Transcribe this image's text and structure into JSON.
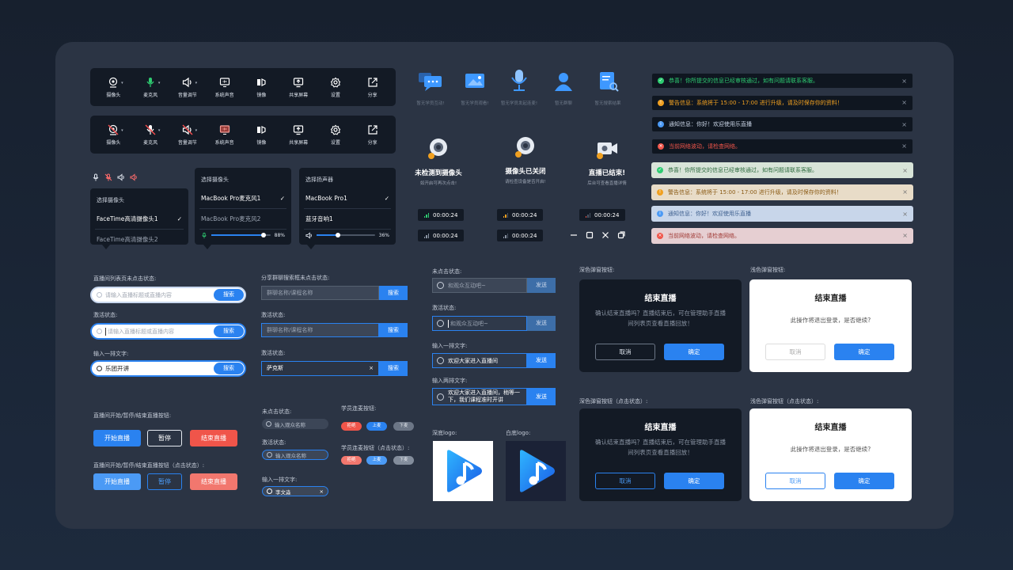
{
  "toolbar_items": [
    "摄像头",
    "麦克风",
    "音量调节",
    "系统声音",
    "镜像",
    "共享屏幕",
    "设置",
    "分享"
  ],
  "camera_dropdown": {
    "title": "选择摄像头",
    "options": [
      "FaceTime高清摄像头1",
      "FaceTime高清摄像头2"
    ]
  },
  "mic_dropdown": {
    "title": "选择摄像头",
    "options": [
      "MacBook Pro麦克风1",
      "MacBook Pro麦克风2"
    ],
    "volume_label": "88%",
    "volume": 0.88
  },
  "speaker_dropdown": {
    "title": "选择扬声器",
    "options": [
      "MacBook Pro1",
      "蓝牙音响1"
    ],
    "volume_label": "36%",
    "volume": 0.36
  },
  "search_rounded": {
    "label1": "直播间列表页未点击状态:",
    "label2": "激活状态:",
    "label3": "输入一排文字:",
    "placeholder": "请输入直播标题或直播内容",
    "value": "乐团开讲",
    "button": "搜索"
  },
  "search_square": {
    "label1": "分享群聊搜索框未点击状态:",
    "label2": "激活状态:",
    "label3": "激活状态:",
    "placeholder": "群聊名称/课程名称",
    "value": "萨克斯",
    "button": "搜索",
    "clear": "×"
  },
  "live_buttons": {
    "label1": "直播间开始/暂停/结束直播按钮:",
    "label2": "直播间开始/暂停/结束直播按钮（点击状态）:",
    "start": "开始直播",
    "pause": "暂停",
    "end": "结束直播"
  },
  "member_search": {
    "label1": "未点击状态:",
    "label2": "激活状态:",
    "label3": "输入一排文字:",
    "placeholder": "输入观众名称",
    "value": "李文淼",
    "clear": "×"
  },
  "student_buttons": {
    "label1": "学员连麦按钮:",
    "label2": "学员连麦按钮（点击状态）:",
    "reject": "拒绝",
    "up": "上麦",
    "down": "下麦"
  },
  "empty_states": [
    "暂无学员互动!",
    "暂无学员观看!",
    "暂无学员发起连麦!",
    "暂无群聊",
    "暂无搜索结果"
  ],
  "camera_states": [
    {
      "title": "未检测到摄像头",
      "sub": "如开启可再次点击!"
    },
    {
      "title": "摄像头已关闭",
      "sub": "请检查设备是否开启!"
    },
    {
      "title": "直播已结束!",
      "sub": "后台可查看直播详情"
    }
  ],
  "timers": [
    "00:00:24",
    "00:00:24",
    "00:00:24",
    "00:00:24",
    "00:00:24"
  ],
  "window_controls": [
    "minimize-icon",
    "maximize-icon",
    "close-icon",
    "restore-icon"
  ],
  "chat_inputs": {
    "label1": "未点击状态:",
    "label2": "激活状态:",
    "label3": "输入一排文字:",
    "label4": "输入两排文字:",
    "placeholder": "和观众互动吧~",
    "value1": "欢迎大家进入直播间",
    "value2a": "欢迎大家进入直播间，稍等一",
    "value2b": "下，我们课程准时开讲",
    "send": "发送"
  },
  "logos": {
    "dark_label": "深底logo:",
    "light_label": "白底logo:"
  },
  "notifications": [
    {
      "type": "success",
      "text": "恭喜！你所提交的信息已经审核通过，如有问题请联系客服。"
    },
    {
      "type": "warning",
      "text": "警告信息：系统将于 15:00 - 17:00 进行升级，请及时保存你的资料！"
    },
    {
      "type": "info",
      "text": "通知信息：你好！欢迎使用乐直播"
    },
    {
      "type": "error",
      "text": "当前网络波动，请检查网络。"
    }
  ],
  "modals": {
    "dark_label": "深色弹窗按钮:",
    "light_label": "浅色弹窗按钮:",
    "dark_label_pressed": "深色弹窗按钮（点击状态）:",
    "light_label_pressed": "浅色弹窗按钮（点击状态）:",
    "dark_title": "结束直播",
    "dark_msg": "确认结束直播吗？直播结束后，可在管理助手直播间列表页查看直播回放！",
    "light_title": "结束直播",
    "light_msg": "此操作将退出登录，是否继续?",
    "cancel": "取消",
    "ok": "确定"
  },
  "colors": {
    "accent": "#2a82f0",
    "danger": "#f0554a",
    "success": "#2ecc71",
    "warning": "#f0a020"
  }
}
